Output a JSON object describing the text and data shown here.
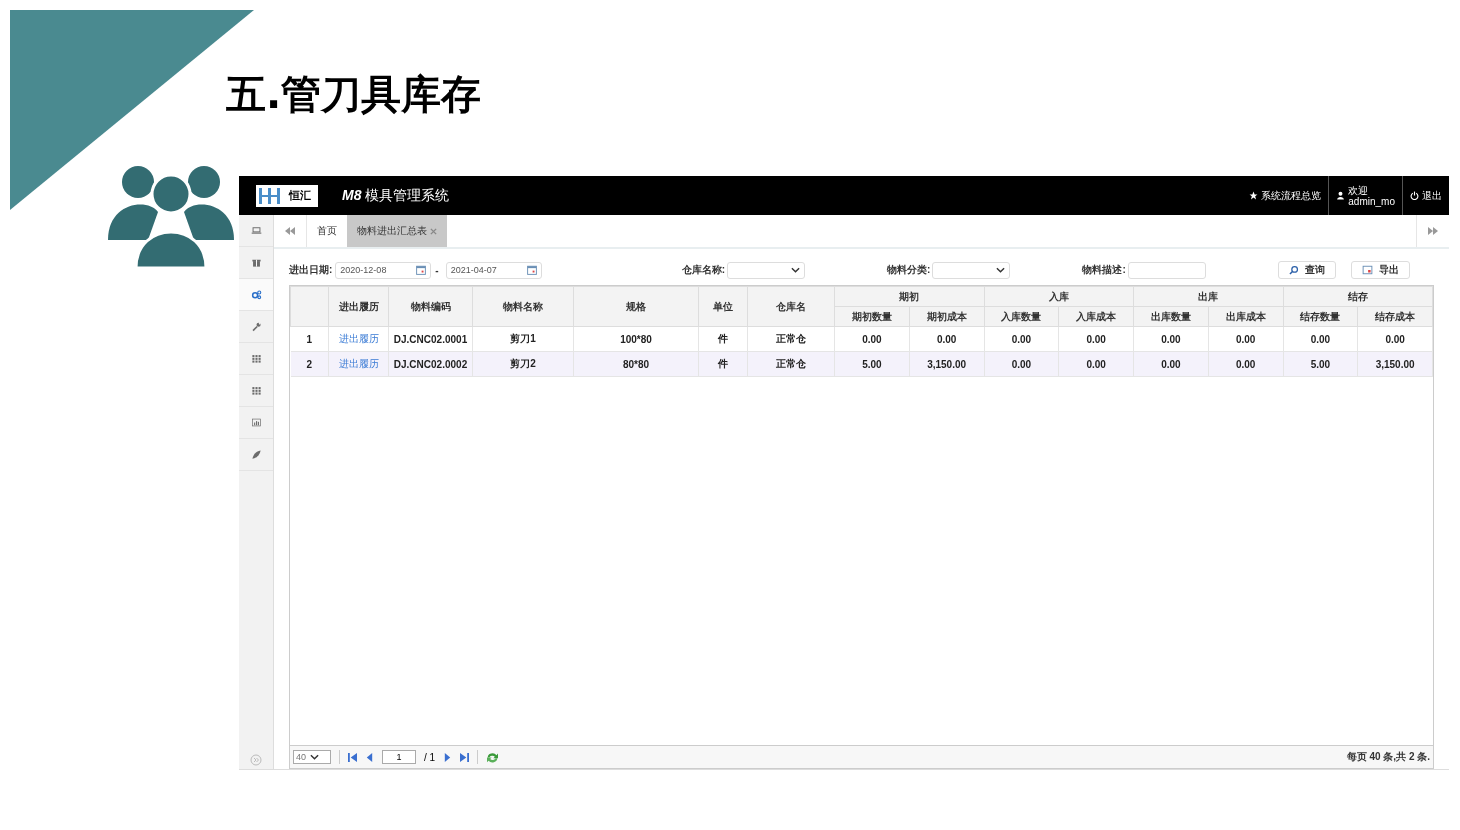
{
  "slide": {
    "title": "五.管刀具库存"
  },
  "app": {
    "logo_text": "恒汇",
    "system_name_prefix": "M8",
    "system_name": "模具管理系统",
    "header_links": [
      {
        "kind": "star",
        "label": "系统流程总览"
      },
      {
        "kind": "user",
        "label": "欢迎",
        "sublabel": "admin_mo"
      },
      {
        "kind": "power",
        "label": "退出"
      }
    ],
    "sidebar": {
      "items": [
        {
          "kind": "laptop",
          "selected": false
        },
        {
          "kind": "gift",
          "selected": false
        },
        {
          "kind": "gears",
          "selected": true
        },
        {
          "kind": "wrench",
          "selected": false
        },
        {
          "kind": "grid",
          "selected": false
        },
        {
          "kind": "grid",
          "selected": false
        },
        {
          "kind": "chart",
          "selected": false
        },
        {
          "kind": "leaf",
          "selected": false
        }
      ]
    },
    "tabs": [
      {
        "label": "首页",
        "selected": false,
        "closable": false
      },
      {
        "label": "物料进出汇总表",
        "selected": true,
        "closable": true
      }
    ],
    "filters": {
      "date_label": "进出日期:",
      "date_from": "2020-12-08",
      "date_separator": "-",
      "date_to": "2021-04-07",
      "warehouse_label": "仓库名称:",
      "category_label": "物料分类:",
      "description_label": "物料描述:"
    },
    "buttons": [
      {
        "kind": "search",
        "label": "查询"
      },
      {
        "kind": "export",
        "label": "导出"
      }
    ],
    "table": {
      "columns": [
        "",
        "进出履历",
        "物料编码",
        "物料名称",
        "规格",
        "单位",
        "仓库名"
      ],
      "groups": [
        {
          "label": "期初",
          "columns": [
            "期初数量",
            "期初成本"
          ]
        },
        {
          "label": "入库",
          "columns": [
            "入库数量",
            "入库成本"
          ]
        },
        {
          "label": "出库",
          "columns": [
            "出库数量",
            "出库成本"
          ]
        },
        {
          "label": "结存",
          "columns": [
            "结存数量",
            "结存成本"
          ]
        }
      ],
      "rows": [
        {
          "selected": false,
          "cells": [
            "1",
            "进出履历",
            "DJ.CNC02.0001",
            "剪刀1",
            "100*80",
            "件",
            "正常仓",
            "0.00",
            "0.00",
            "0.00",
            "0.00",
            "0.00",
            "0.00",
            "0.00",
            "0.00"
          ]
        },
        {
          "selected": true,
          "cells": [
            "2",
            "进出履历",
            "DJ.CNC02.0002",
            "剪刀2",
            "80*80",
            "件",
            "正常仓",
            "5.00",
            "3,150.00",
            "0.00",
            "0.00",
            "0.00",
            "0.00",
            "5.00",
            "3,150.00"
          ]
        }
      ]
    },
    "pager": {
      "page_size": "40",
      "page": "1",
      "page_total": "/ 1",
      "summary": "每页 40 条,共 2 条."
    }
  }
}
